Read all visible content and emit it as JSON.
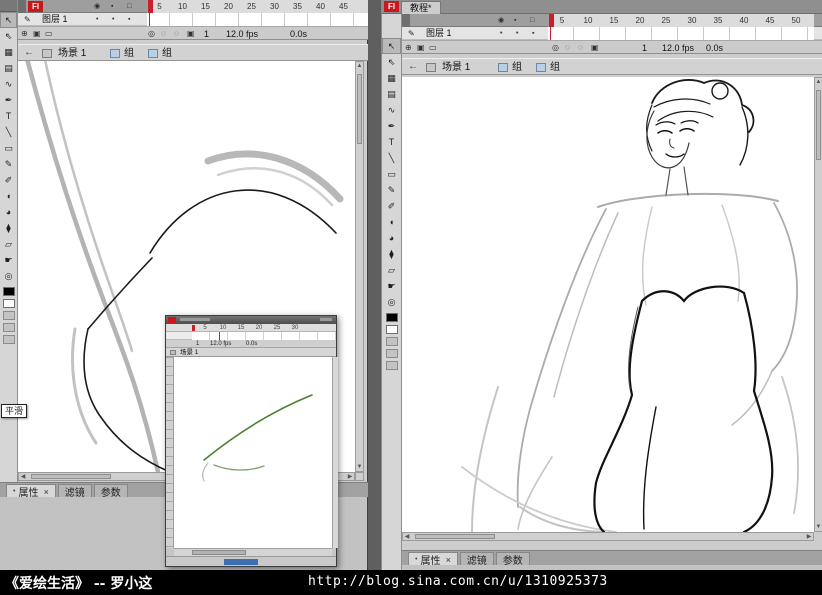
{
  "brand": "Fl",
  "icons": {
    "eye": "◉",
    "lock": "▪",
    "outline": "□",
    "dot": "•",
    "square": "▪",
    "pencil": "✎",
    "back": "←",
    "add": "⊕",
    "folder": "▣",
    "trash": "▭",
    "onion": "◌",
    "onion2": "◎",
    "tab_dot": "•",
    "close": "×",
    "up": "▲",
    "down": "▼",
    "left_arrow": "◀",
    "right_arrow": "▶"
  },
  "toolbar": {
    "tools": [
      {
        "name": "selection-tool",
        "glyph": "↖"
      },
      {
        "name": "subselection-tool",
        "glyph": "⇖"
      },
      {
        "name": "free-transform-tool",
        "glyph": "▦"
      },
      {
        "name": "gradient-transform-tool",
        "glyph": "▤"
      },
      {
        "name": "lasso-tool",
        "glyph": "∿"
      },
      {
        "name": "pen-tool",
        "glyph": "✒"
      },
      {
        "name": "text-tool",
        "glyph": "T"
      },
      {
        "name": "line-tool",
        "glyph": "╲"
      },
      {
        "name": "rectangle-tool",
        "glyph": "▭"
      },
      {
        "name": "pencil-tool",
        "glyph": "✎"
      },
      {
        "name": "brush-tool",
        "glyph": "✐"
      },
      {
        "name": "ink-bottle-tool",
        "glyph": "◖"
      },
      {
        "name": "paint-bucket-tool",
        "glyph": "◕"
      },
      {
        "name": "eyedropper-tool",
        "glyph": "⧫"
      },
      {
        "name": "eraser-tool",
        "glyph": "▱"
      },
      {
        "name": "hand-tool",
        "glyph": "☛"
      },
      {
        "name": "zoom-tool",
        "glyph": "◎"
      }
    ]
  },
  "left_window": {
    "timeline": {
      "layer_name": "图层 1",
      "ruler": [
        "5",
        "10",
        "15",
        "20",
        "25",
        "30",
        "35",
        "40",
        "45"
      ],
      "current_frame": "1",
      "frame_rate": "12.0 fps",
      "elapsed_time": "0.0s"
    },
    "edit_bar": {
      "scene": "场景 1",
      "group_a": "组",
      "group_b": "组"
    },
    "panel": {
      "properties": "属性",
      "filters": "滤镜",
      "parameters": "参数"
    },
    "tooltip": "平滑"
  },
  "right_window": {
    "doc_tab": "教程*",
    "timeline": {
      "layer_name": "图层 1",
      "ruler": [
        "5",
        "10",
        "15",
        "20",
        "25",
        "30",
        "35",
        "40",
        "45",
        "50"
      ],
      "current_frame": "1",
      "frame_rate": "12.0 fps",
      "elapsed_time": "0.0s"
    },
    "edit_bar": {
      "scene": "场景 1",
      "group_a": "组",
      "group_b": "组"
    },
    "panel": {
      "properties": "属性",
      "filters": "滤镜",
      "parameters": "参数"
    }
  },
  "inset_window": {
    "ruler": [
      "5",
      "10",
      "15",
      "20",
      "25",
      "30"
    ],
    "scene": "场景 1",
    "current_frame": "1",
    "frame_rate": "12.0 fps",
    "elapsed_time": "0.0s"
  },
  "footer": {
    "title": "《爱绘生活》 -- 罗小这",
    "url": "http://blog.sina.com.cn/u/1310925373"
  }
}
